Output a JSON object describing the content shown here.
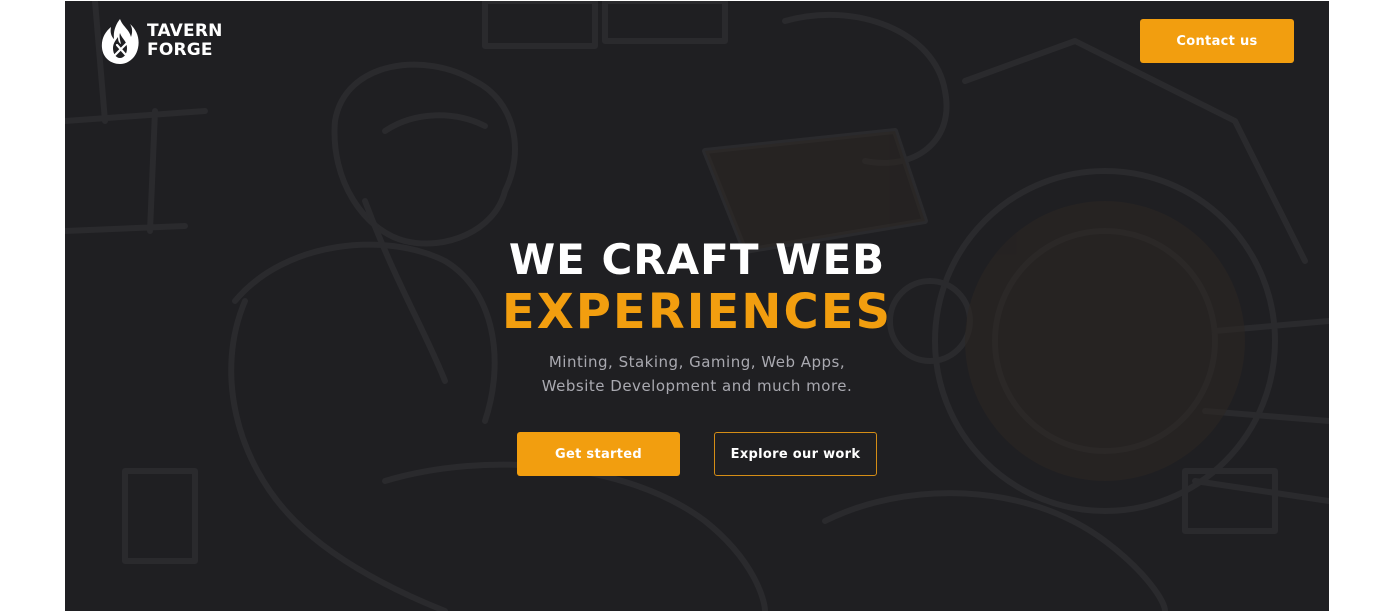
{
  "brand": {
    "logo_icon": "flame-icon",
    "name_line1": "TAVERN",
    "name_line2": "FORGE"
  },
  "header": {
    "contact_label": "Contact us"
  },
  "hero": {
    "headline_line1": "WE CRAFT WEB",
    "headline_line2": "EXPERIENCES",
    "subtitle_line1": "Minting, Staking, Gaming, Web Apps,",
    "subtitle_line2": "Website Development and much more.",
    "primary_cta": "Get started",
    "secondary_cta": "Explore our work",
    "background_illustration": "dwarf-blacksmith-forge"
  },
  "colors": {
    "accent": "#f29e0f",
    "background": "#1f1f22",
    "text": "#ffffff",
    "muted_text": "#a9a9b0"
  }
}
